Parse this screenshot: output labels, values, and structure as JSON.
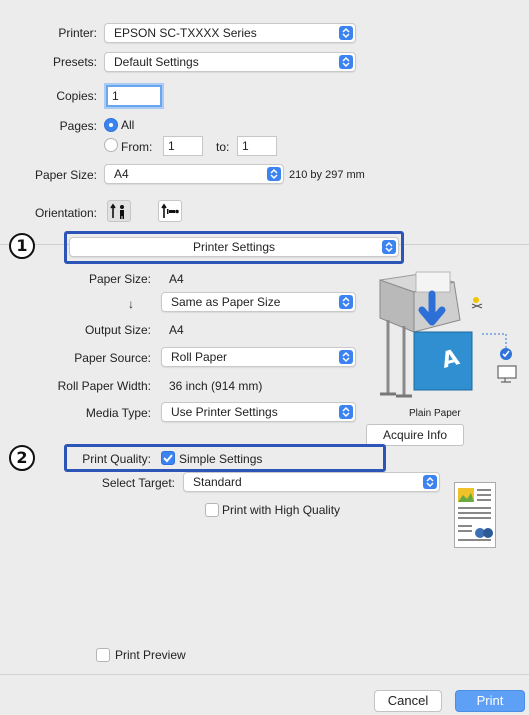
{
  "printer": {
    "label": "Printer:",
    "value": "EPSON SC-TXXXX Series"
  },
  "presets": {
    "label": "Presets:",
    "value": "Default Settings"
  },
  "copies": {
    "label": "Copies:",
    "value": "1"
  },
  "pages": {
    "label": "Pages:",
    "all_label": "All",
    "from_label": "From:",
    "from_value": "1",
    "to_label": "to:",
    "to_value": "1",
    "selected": "All"
  },
  "paper_size": {
    "label": "Paper Size:",
    "value": "A4",
    "dims": "210 by 297 mm"
  },
  "orientation": {
    "label": "Orientation:",
    "selected": "portrait"
  },
  "panel_select": {
    "value": "Printer Settings"
  },
  "settings": {
    "paper_size_label": "Paper Size:",
    "paper_size_value": "A4",
    "arrow_label": "↓",
    "same_as_value": "Same as Paper Size",
    "output_size_label": "Output Size:",
    "output_size_value": "A4",
    "paper_source_label": "Paper Source:",
    "paper_source_value": "Roll Paper",
    "roll_width_label": "Roll Paper Width:",
    "roll_width_value": "36 inch (914 mm)",
    "media_type_label": "Media Type:",
    "media_type_value": "Use Printer Settings",
    "plain_paper_caption": "Plain Paper",
    "acquire_info_label": "Acquire Info",
    "print_quality_label": "Print Quality:",
    "simple_settings_label": "Simple Settings",
    "simple_settings_checked": true,
    "select_target_label": "Select Target:",
    "select_target_value": "Standard",
    "high_quality_label": "Print with High Quality",
    "high_quality_checked": false
  },
  "callouts": {
    "one": "1",
    "two": "2"
  },
  "footer": {
    "print_preview_label": "Print Preview",
    "cancel_label": "Cancel",
    "print_label": "Print"
  },
  "colors": {
    "accent": "#3a83f0",
    "callout_box": "#2d55b8",
    "printer_blue": "#2f8fd0"
  }
}
